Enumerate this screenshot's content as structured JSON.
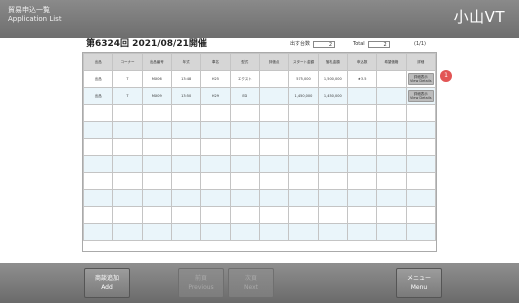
{
  "header": {
    "title_line1": "貿易申込一覧",
    "title_line2": "Application List",
    "brand": "小山VT"
  },
  "session": {
    "title": "第6324回 2021/08/21開催",
    "filter_label": "出す台数",
    "filter_value": "2",
    "total_label": "Total",
    "total_value": "2",
    "page_indicator": "(1/1)"
  },
  "columns": [
    "出品",
    "コーナー",
    "出品番号",
    "年式",
    "車名",
    "型式",
    "評価点",
    "スタート金額",
    "落札金額",
    "申込数",
    "希望価格",
    "詳細"
  ],
  "rows": [
    {
      "c1": "出品",
      "c2": "T",
      "c3": "MX06",
      "c4": "13:48",
      "c5": "H25",
      "c6": "エクスト",
      "c7": "",
      "c8": "575,000",
      "c9": "1,500,000",
      "c10": "★3.5",
      "c11": "",
      "c12": "詳細表示\nView Details"
    },
    {
      "c1": "出品",
      "c2": "T",
      "c3": "MX09",
      "c4": "13:50",
      "c5": "H29",
      "c6": "ED",
      "c7": "",
      "c8": "1,450,000",
      "c9": "1,450,000",
      "c10": "",
      "c11": "",
      "c12": "詳細表示\nView Details"
    }
  ],
  "empty_rows": 8,
  "badge": "1",
  "footer": {
    "add_jp": "商談追加",
    "add_en": "Add",
    "prev_jp": "前頁",
    "prev_en": "Previous",
    "next_jp": "次頁",
    "next_en": "Next",
    "menu_jp": "メニュー",
    "menu_en": "Menu"
  }
}
